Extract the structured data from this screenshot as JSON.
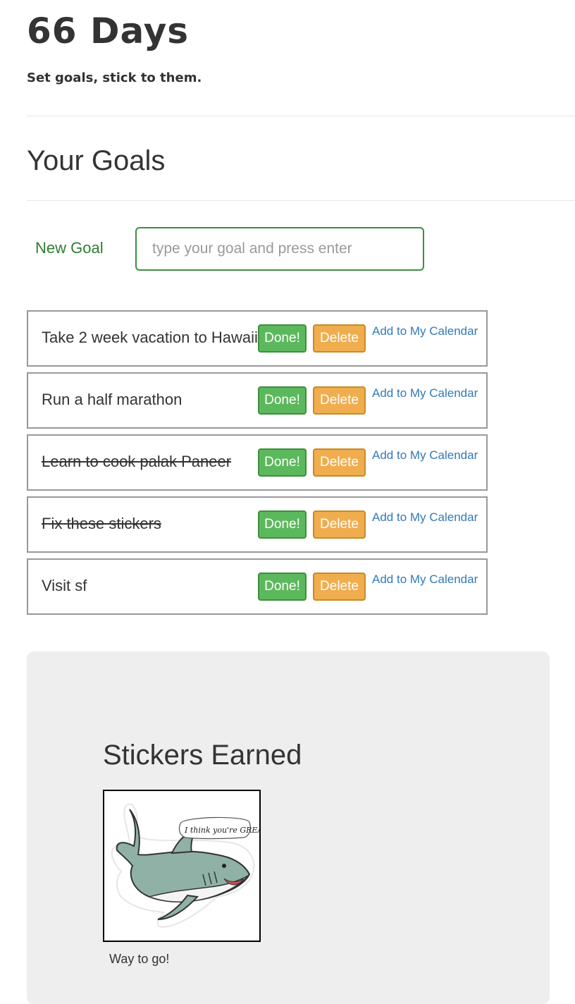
{
  "header": {
    "app_title": "66 Days",
    "tagline": "Set goals, stick to them."
  },
  "goals_section": {
    "title": "Your Goals",
    "new_goal_label": "New Goal",
    "new_goal_placeholder": "type your goal and press enter",
    "new_goal_value": ""
  },
  "goals": [
    {
      "text": "Take 2 week vacation to Hawaii",
      "completed": false,
      "done_label": "Done!",
      "delete_label": "Delete",
      "calendar_label": "Add to My Calendar"
    },
    {
      "text": "Run a half marathon",
      "completed": false,
      "done_label": "Done!",
      "delete_label": "Delete",
      "calendar_label": "Add to My Calendar"
    },
    {
      "text": "Learn to cook palak Paneer",
      "completed": true,
      "done_label": "Done!",
      "delete_label": "Delete",
      "calendar_label": "Add to My Calendar"
    },
    {
      "text": "Fix these stickers",
      "completed": true,
      "done_label": "Done!",
      "delete_label": "Delete",
      "calendar_label": "Add to My Calendar"
    },
    {
      "text": "Visit sf",
      "completed": false,
      "done_label": "Done!",
      "delete_label": "Delete",
      "calendar_label": "Add to My Calendar"
    }
  ],
  "stickers": {
    "title": "Stickers Earned",
    "items": [
      {
        "icon": "shark-sticker-icon",
        "sticker_text": "I think you're GREAT!!",
        "caption": "Way to go!"
      }
    ]
  },
  "colors": {
    "done_button": "#5cb85c",
    "delete_button": "#f0ad4e",
    "link": "#337ab7",
    "new_goal_accent": "#2e7d32",
    "panel_background": "#eeeeee"
  }
}
